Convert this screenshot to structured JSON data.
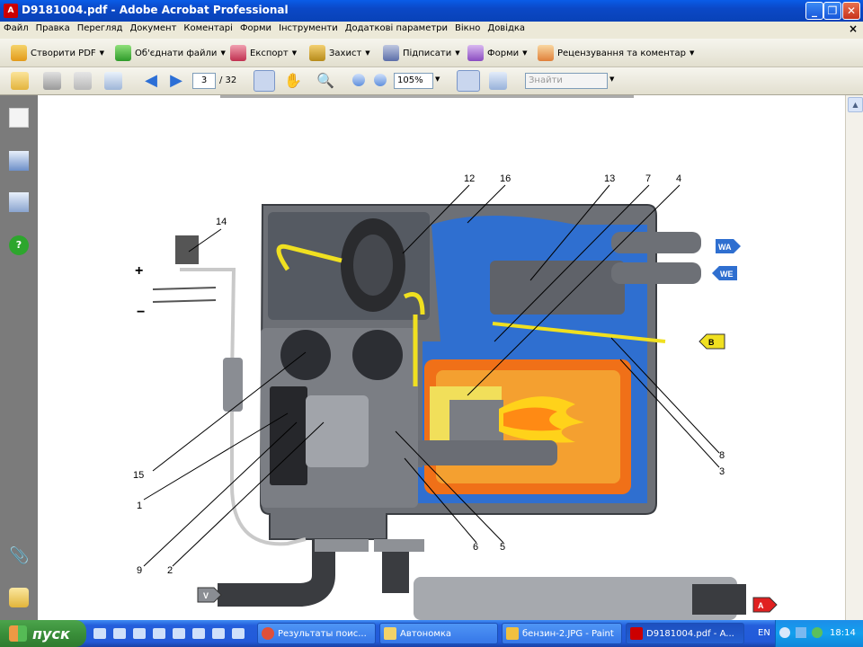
{
  "window": {
    "title": "D9181004.pdf - Adobe Acrobat Professional"
  },
  "menu": [
    "Файл",
    "Правка",
    "Перегляд",
    "Документ",
    "Коментарі",
    "Форми",
    "Інструменти",
    "Додаткові параметри",
    "Вікно",
    "Довідка"
  ],
  "toolbar1": {
    "create_pdf": "Створити PDF",
    "combine": "Об'єднати файли",
    "export": "Експорт",
    "secure": "Захист",
    "sign": "Підписати",
    "forms": "Форми",
    "review": "Рецензування та коментар"
  },
  "toolbar2": {
    "page_current": "3",
    "page_total": "/ 32",
    "zoom": "105%",
    "find_placeholder": "Знайти"
  },
  "diagram": {
    "callouts": [
      "12",
      "16",
      "13",
      "7",
      "4",
      "14",
      "15",
      "1",
      "9",
      "2",
      "6",
      "5",
      "8",
      "3"
    ],
    "plus": "+",
    "minus": "−",
    "tag_wa": "WA",
    "tag_we": "WE",
    "tag_b": "B",
    "tag_v": "V",
    "tag_a": "A"
  },
  "taskbar": {
    "start": "пуск",
    "tasks": [
      "Результаты поис...",
      "Автономка",
      "бензин-2.JPG - Paint",
      "D9181004.pdf - A..."
    ],
    "lang": "EN",
    "time": "18:14"
  },
  "colors": {
    "titlebar": "#0b48c6",
    "taskbar": "#245edb",
    "sidebar": "#7b7b7b",
    "coolant": "#2f6fd0",
    "flame": "#f07018",
    "fuel_line": "#f0e020"
  }
}
